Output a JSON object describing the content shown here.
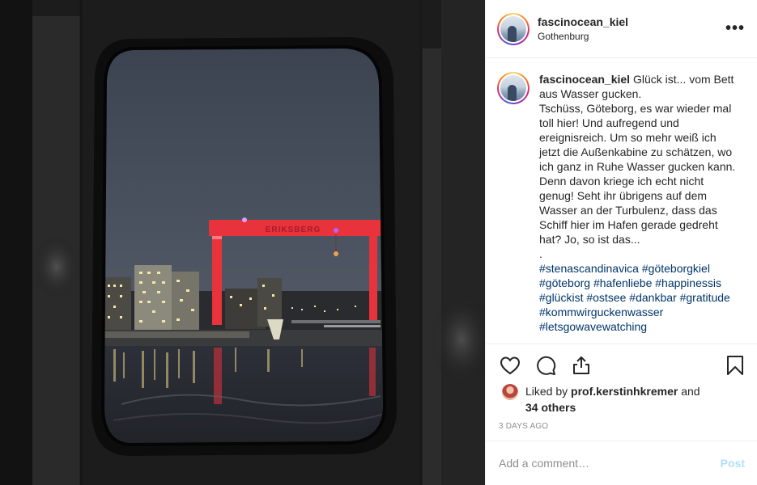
{
  "photo": {
    "crane_sign": "ERIKSBERG"
  },
  "header": {
    "username": "fascinocean_kiel",
    "location": "Gothenburg",
    "more_icon": "more-horizontal-icon",
    "more_label": "•••"
  },
  "caption": {
    "username": "fascinocean_kiel",
    "lines": [
      "Glück ist... vom Bett",
      "aus Wasser gucken.",
      "Tschüss, Göteborg, es war wieder mal",
      "toll hier! Und aufregend und",
      "ereignisreich. Um so mehr weiß ich",
      "jetzt die Außenkabine zu schätzen, wo",
      "ich ganz in Ruhe Wasser gucken kann.",
      "Denn davon kriege ich echt nicht",
      "genug! Seht ihr übrigens auf dem",
      "Wasser an der Turbulenz, dass das",
      "Schiff hier im Hafen gerade gedreht",
      "hat? Jo, so ist das...",
      "."
    ],
    "hashtags": {
      "stenascandinavica": "#stenascandinavica",
      "goteborgkiel": "#göteborgkiel",
      "goteborg": "#göteborg",
      "hafenliebe": "#hafenliebe",
      "happinessis": "#happinessis",
      "glueckist": "#glückist",
      "ostsee": "#ostsee",
      "dankbar": "#dankbar",
      "gratitude": "#gratitude",
      "kommwirguckenwasser": "#kommwirguckenwasser",
      "letsgowavewatching": "#letsgowavewatching"
    }
  },
  "actions": {
    "like_icon": "heart-icon",
    "comment_icon": "comment-bubble-icon",
    "share_icon": "share-icon",
    "save_icon": "bookmark-icon"
  },
  "likes": {
    "prefix": "Liked by ",
    "user": "prof.kerstinhkremer",
    "connector": " and",
    "others": "34 others"
  },
  "timestamp": "3 DAYS AGO",
  "comment_box": {
    "placeholder": "Add a comment…",
    "post_label": "Post"
  },
  "colors": {
    "text": "#262626",
    "hashtag": "#003569",
    "muted": "#8e8e8e",
    "post_disabled": "#b2dffc",
    "divider": "#efefef",
    "crane_red": "#e8323c"
  }
}
